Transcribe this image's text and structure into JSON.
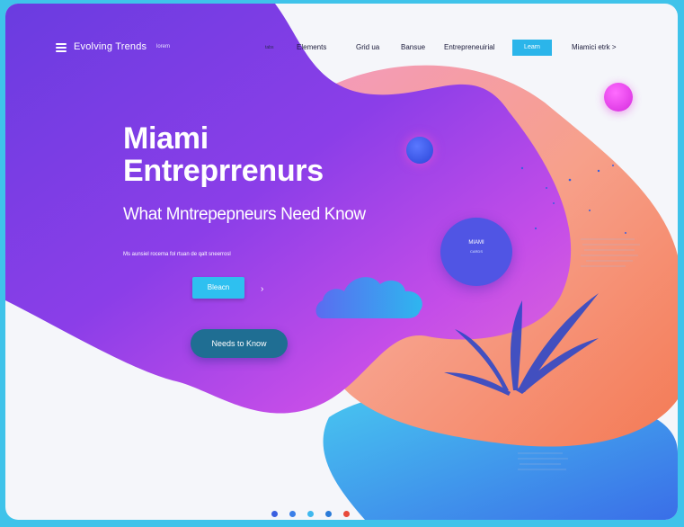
{
  "nav": {
    "brand": "Evolving Trends",
    "brand_sub": "lorem",
    "small_link": "tabs",
    "links": [
      "Elements",
      "Grid ua",
      "Bansue",
      "Entrepreneuirial"
    ],
    "button": "Learn",
    "last_link": "Miamici etrk >"
  },
  "hero": {
    "title_line1": "Miami",
    "title_line2": "Entreprrenurs",
    "subtitle": "What Mntrepepneurs Need Know",
    "tagline": "Ms aunsiel rocema fol rtuan de qalt sneerrosl",
    "primary_button": "Bleacn",
    "arrow": "›",
    "secondary_button": "Needs to Know"
  },
  "badge": {
    "line1": "MIAMI",
    "line2": "CARDS"
  },
  "pagination": {
    "count": 5,
    "active": 3
  },
  "colors": {
    "frame_bg": "#3fc3ea",
    "page_bg": "#f5f6fa",
    "nav_button": "#2bb5ea",
    "primary_button": "#2ec0f0",
    "secondary_button": "#1f6e93",
    "dot_blue": "#3a5fe0",
    "dot_magenta": "#e83ce8"
  }
}
